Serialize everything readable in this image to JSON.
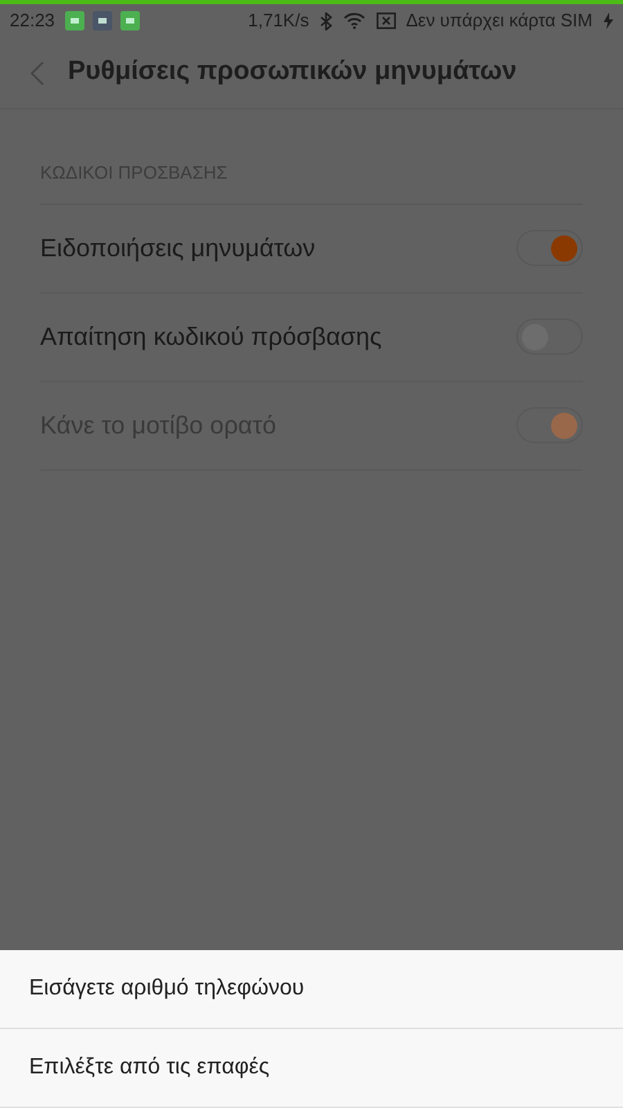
{
  "status_bar": {
    "time": "22:23",
    "notifications": [
      {
        "color": "#4caf50"
      },
      {
        "color": "#4a5568"
      },
      {
        "color": "#4caf50"
      }
    ],
    "speed": "1,71K/s",
    "carrier": "Δεν υπάρχει κάρτα SIM"
  },
  "header": {
    "title": "Ρυθμίσεις προσωπικών μηνυμάτων"
  },
  "section": {
    "title": "ΚΩΔΙΚΟΙ ΠΡΟΣΒΑΣΗΣ"
  },
  "settings": [
    {
      "label": "Ειδοποιήσεις μηνυμάτων",
      "on": true,
      "disabled": false
    },
    {
      "label": "Απαίτηση κωδικού πρόσβασης",
      "on": false,
      "disabled": false
    },
    {
      "label": "Κάνε το μοτίβο ορατό",
      "on": true,
      "disabled": true
    }
  ],
  "sheet": {
    "options": [
      "Εισάγετε αριθμό τηλεφώνου",
      "Επιλέξτε από τις επαφές"
    ]
  }
}
